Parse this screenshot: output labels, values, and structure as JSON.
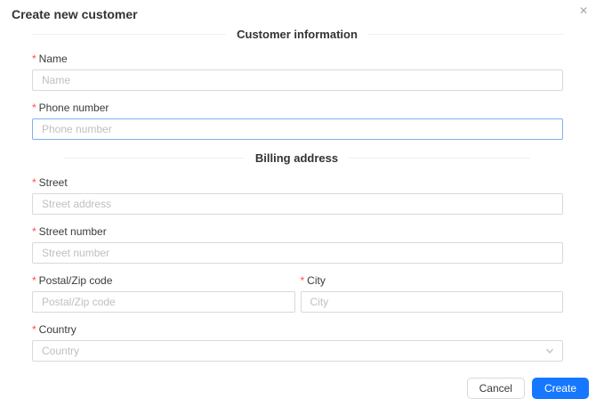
{
  "modal": {
    "title": "Create new customer",
    "close_glyph": "✕"
  },
  "sections": {
    "customer_information": "Customer information",
    "billing_address": "Billing address"
  },
  "ui": {
    "required_mark": "*"
  },
  "fields": {
    "name": {
      "label": "Name",
      "placeholder": "Name"
    },
    "phone_number": {
      "label": "Phone number",
      "placeholder": "Phone number"
    },
    "street": {
      "label": "Street",
      "placeholder": "Street address"
    },
    "street_number": {
      "label": "Street number",
      "placeholder": "Street number"
    },
    "postal_zip_code": {
      "label": "Postal/Zip code",
      "placeholder": "Postal/Zip code"
    },
    "city": {
      "label": "City",
      "placeholder": "City"
    },
    "country": {
      "label": "Country",
      "placeholder": "Country"
    }
  },
  "footer": {
    "cancel_label": "Cancel",
    "create_label": "Create"
  },
  "colors": {
    "primary": "#1677ff",
    "required_mark": "#ff4d4f",
    "focused_input_border": "#7fb0f0",
    "input_border": "#d9d9d9",
    "divider_line": "#f0f0f0",
    "placeholder_text": "#bfbfbf"
  }
}
